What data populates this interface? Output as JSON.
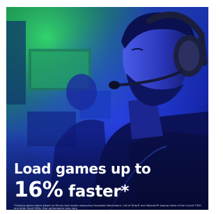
{
  "headline": {
    "line1": "Load games up to",
    "percent": "16%",
    "line2_rest": " faster*"
  },
  "disclaimer": "*Gaming speed claims based on Micron test results measuring Forspoken Benchmark, Call of Duty® and Valorant® bootup times of the Crucial T500 and other Gen4 SSDs. Your performance may vary.",
  "colors": {
    "background": "#0a1040",
    "accent_blue": "#2a3cff",
    "accent_green": "#2fd85a",
    "text": "#ffffff"
  }
}
